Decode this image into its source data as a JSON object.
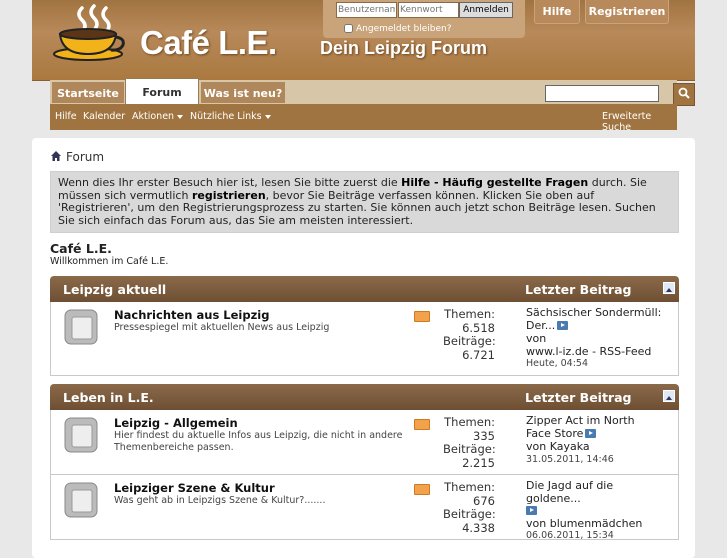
{
  "logo": {
    "text": "Café L.E.",
    "slogan": "Dein Leipzig Forum"
  },
  "login": {
    "username_placeholder": "Benutzername",
    "password_placeholder": "Kennwort",
    "submit_label": "Anmelden",
    "remember_label": "Angemeldet bleiben?"
  },
  "header_buttons": {
    "help": "Hilfe",
    "register": "Registrieren"
  },
  "nav": {
    "tabs": [
      {
        "label": "Startseite"
      },
      {
        "label": "Forum"
      },
      {
        "label": "Was ist neu?"
      }
    ]
  },
  "subnav": {
    "items": [
      "Hilfe",
      "Kalender",
      "Aktionen",
      "Nützliche Links"
    ],
    "advanced_search": "Erweiterte Suche"
  },
  "breadcrumb": {
    "label": "Forum"
  },
  "notice": {
    "p1": "Wenn dies Ihr erster Besuch hier ist, lesen Sie bitte zuerst die ",
    "faq": "Hilfe - Häufig gestellte Fragen",
    "p2": " durch. Sie müssen sich vermutlich ",
    "register": "registrieren",
    "p3": ", bevor Sie Beiträge verfassen können. Klicken Sie oben auf 'Registrieren', um den Registrierungsprozess zu starten. Sie können auch jetzt schon Beiträge lesen. Suchen Sie sich einfach das Forum aus, das Sie am meisten interessiert."
  },
  "forum": {
    "title": "Café L.E.",
    "description": "Willkommen im Café L.E."
  },
  "categories": [
    {
      "name": "Leipzig aktuell",
      "last_post_label": "Letzter Beitrag",
      "forums": [
        {
          "name": "Nachrichten aus Leipzig",
          "description": "Pressespiegel mit aktuellen News aus Leipzig",
          "themen_label": "Themen:",
          "themen": "6.518",
          "beitraege_label": "Beiträge:",
          "beitraege": "6.721",
          "last_title": "Sächsischer Sondermüll: Der...",
          "last_by": "von",
          "last_user": "www.l-iz.de - RSS-Feed",
          "last_date": "Heute, 04:54"
        }
      ]
    },
    {
      "name": "Leben in L.E.",
      "last_post_label": "Letzter Beitrag",
      "forums": [
        {
          "name": "Leipzig - Allgemein",
          "description": "Hier findest du aktuelle Infos aus Leipzig, die nicht in andere Themenbereiche passen.",
          "themen_label": "Themen:",
          "themen": "335",
          "beitraege_label": "Beiträge:",
          "beitraege": "2.215",
          "last_title": "Zipper Act im North Face Store",
          "last_by": "von Kayaka",
          "last_date": "31.05.2011, 14:46"
        },
        {
          "name": "Leipziger Szene & Kultur",
          "description": "Was geht ab in Leipzigs Szene & Kultur?.......",
          "themen_label": "Themen:",
          "themen": "676",
          "beitraege_label": "Beiträge:",
          "beitraege": "4.338",
          "last_title": "Die Jagd auf die goldene...",
          "last_by": "von blumenmädchen",
          "last_date": "06.06.2011, 15:34"
        }
      ]
    }
  ],
  "colors": {
    "brand": "#a07440",
    "category_header": "#7a5a3d",
    "notice_bg": "#d9d9d9"
  }
}
